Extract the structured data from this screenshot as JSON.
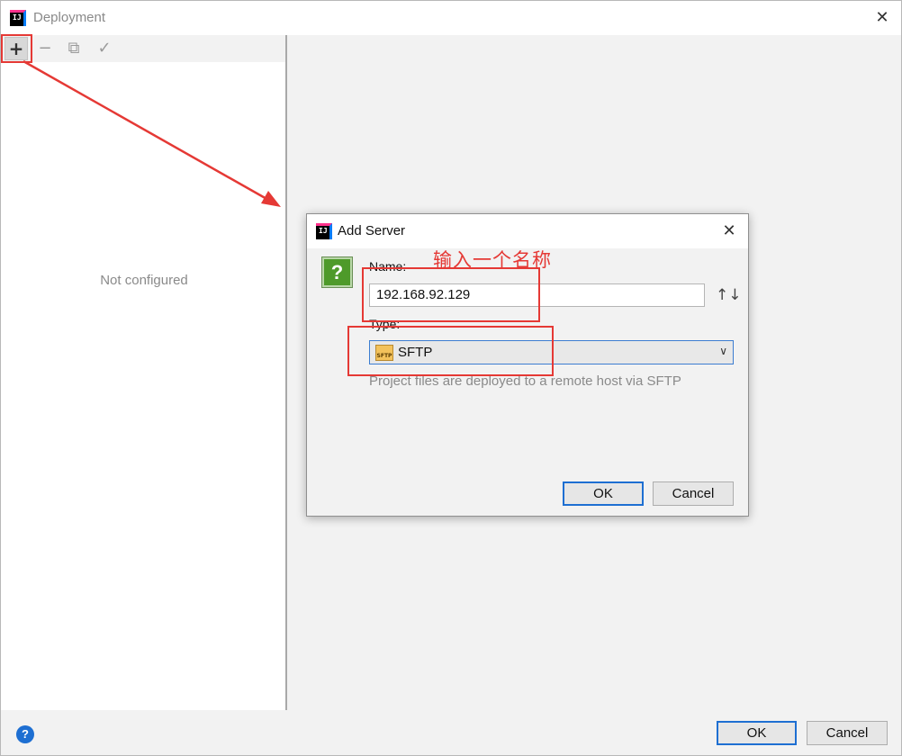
{
  "window": {
    "title": "Deployment",
    "close_glyph": "✕",
    "app_icon_text": "IJ"
  },
  "toolbar": {
    "add_glyph": "+",
    "remove_glyph": "−",
    "copy_glyph": "⧉",
    "apply_glyph": "✓"
  },
  "left_panel": {
    "empty_text": "Not configured"
  },
  "bottom": {
    "help_glyph": "?",
    "ok_label": "OK",
    "cancel_label": "Cancel"
  },
  "dialog": {
    "title": "Add Server",
    "close_glyph": "✕",
    "question_glyph": "?",
    "name_label": "Name:",
    "name_value": "192.168.92.129",
    "sort_glyph": "↑↓",
    "type_label": "Type:",
    "type_value": "SFTP",
    "type_icon_text": "SFTP",
    "chevron_glyph": "∨",
    "type_description": "Project files are deployed to a remote host via SFTP",
    "ok_label": "OK",
    "cancel_label": "Cancel"
  },
  "annotation": {
    "text": "输入一个名称",
    "color": "#e53935"
  },
  "colors": {
    "accent": "#1e6fd2",
    "annotation_red": "#e53935"
  }
}
